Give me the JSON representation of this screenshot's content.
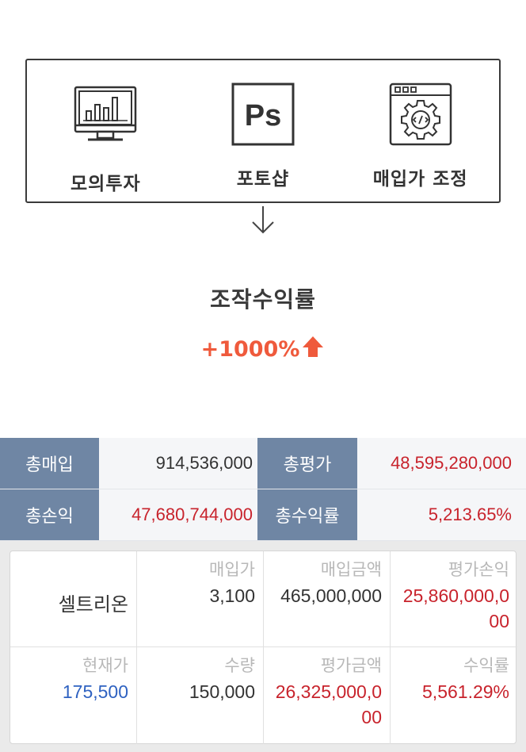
{
  "flow": {
    "items": [
      {
        "label": "모의투자",
        "icon": "monitor-chart-icon"
      },
      {
        "label": "포토샵",
        "icon": "photoshop-icon"
      },
      {
        "label": "매입가 조정",
        "icon": "code-settings-icon"
      }
    ],
    "ps_text": "Ps"
  },
  "result": {
    "title": "조작수익률",
    "value": "+1000%",
    "accent_color": "#ef5a3c"
  },
  "summary": {
    "total_purchase_label": "총매입",
    "total_purchase": "914,536,000",
    "total_valuation_label": "총평가",
    "total_valuation": "48,595,280,000",
    "total_pl_label": "총손익",
    "total_pl": "47,680,744,000",
    "total_return_label": "총수익률",
    "total_return": "5,213.65%"
  },
  "holding": {
    "name": "셀트리온",
    "purchase_price_label": "매입가",
    "purchase_price": "3,100",
    "purchase_amount_label": "매입금액",
    "purchase_amount": "465,000,000",
    "valuation_pl_label": "평가손익",
    "valuation_pl": "25,860,000,000",
    "current_price_label": "현재가",
    "current_price": "175,500",
    "quantity_label": "수량",
    "quantity": "150,000",
    "valuation_amount_label": "평가금액",
    "valuation_amount": "26,325,000,000",
    "return_label": "수익률",
    "return": "5,561.29%"
  },
  "colors": {
    "header_bg": "#6f86a4",
    "positive": "#c8232c",
    "price_up_blue": "#2f62c1"
  }
}
